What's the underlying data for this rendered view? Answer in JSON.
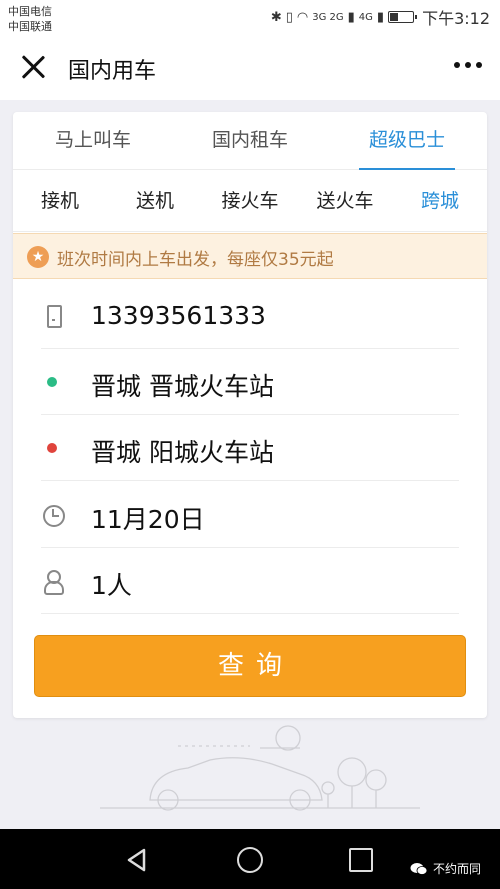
{
  "status_bar": {
    "carrier_1": "中国电信",
    "carrier_2": "中国联通",
    "network_1": "3G 2G",
    "network_2": "4G",
    "time": "下午3:12"
  },
  "nav": {
    "title": "国内用车",
    "close_icon": "close-icon",
    "more_icon": "more-icon"
  },
  "main_tabs": [
    {
      "label": "马上叫车",
      "active": false
    },
    {
      "label": "国内租车",
      "active": false
    },
    {
      "label": "超级巴士",
      "active": true
    }
  ],
  "sub_tabs": [
    {
      "label": "接机",
      "active": false
    },
    {
      "label": "送机",
      "active": false
    },
    {
      "label": "接火车",
      "active": false
    },
    {
      "label": "送火车",
      "active": false
    },
    {
      "label": "跨城",
      "active": true
    }
  ],
  "notice": {
    "icon": "star-icon",
    "text": "班次时间内上车出发，每座仅35元起"
  },
  "form": {
    "phone": "13393561333",
    "origin": "晋城 晋城火车站",
    "destination": "晋城 阳城火车站",
    "date": "11月20日",
    "passengers": "1人"
  },
  "query_button": "查询",
  "watermark": "不约而同",
  "colors": {
    "accent_blue": "#2a8fd8",
    "button_orange": "#f7a01f",
    "origin_dot": "#2bbc86",
    "destination_dot": "#e0443c",
    "notice_bg": "#fdf1e0",
    "notice_text": "#b07a43"
  }
}
